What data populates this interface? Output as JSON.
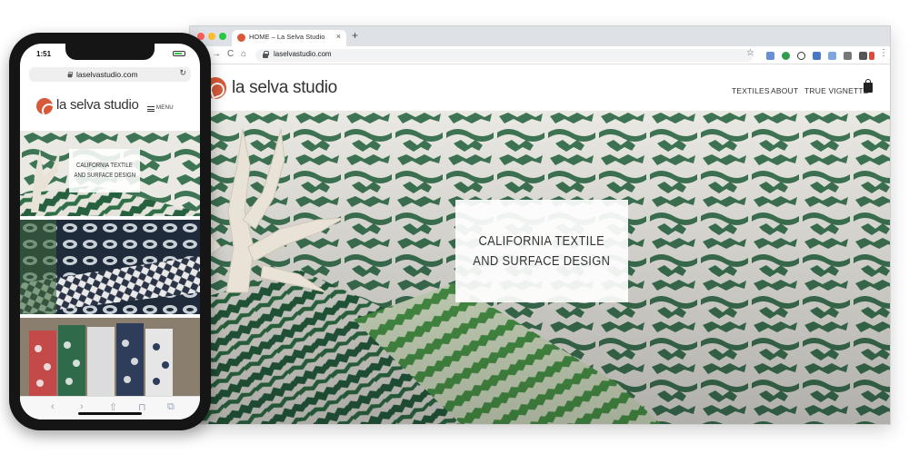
{
  "browser": {
    "tab_title": "HOME – La Selva Studio",
    "tab_close": "×",
    "new_tab": "+",
    "back": "←",
    "forward": "→",
    "reload": "C",
    "home": "⌂",
    "url": "laselvastudio.com",
    "bookmark_star": "☆",
    "menu": "⋮"
  },
  "site": {
    "logo_text": "la selva studio",
    "nav": [
      "TEXTILES",
      "ABOUT",
      "TRUE VIGNETTE"
    ],
    "hero_line1": "CALIFORNIA TEXTILE",
    "hero_line2": "AND SURFACE DESIGN"
  },
  "phone": {
    "time": "1:51",
    "url": "laselvastudio.com",
    "reload": "↻",
    "logo_text": "la selva studio",
    "menu_label": "MENU",
    "hero_line1": "CALIFORNIA TEXTILE",
    "hero_line2": "AND SURFACE DESIGN",
    "toolbar": [
      "‹",
      "›",
      "⇧",
      "⊓",
      "⧉"
    ]
  },
  "colors": {
    "brand": "#d65a3a",
    "textile_green": "#2f6b4a",
    "textile_navy": "#1f2a3a",
    "textile_red": "#c44a4a"
  }
}
